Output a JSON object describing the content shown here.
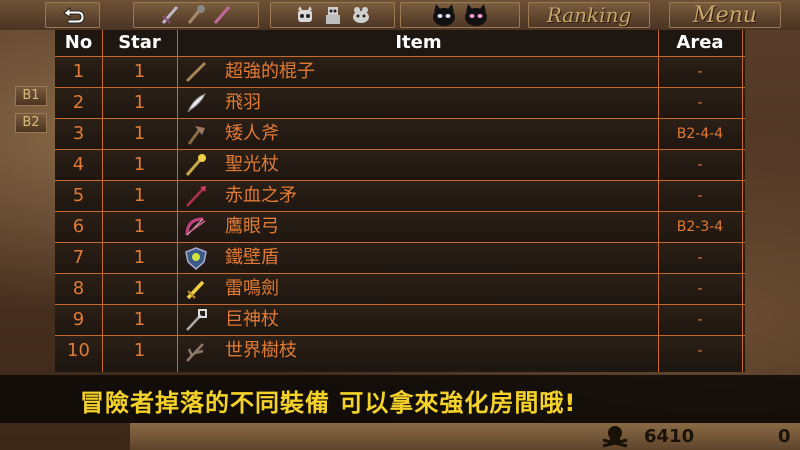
{
  "toolbar": {
    "ranking_label": "Ranking",
    "menu_label": "Menu"
  },
  "side_tags": [
    "B1",
    "B2"
  ],
  "table": {
    "headers": {
      "no": "No",
      "star": "Star",
      "item": "Item",
      "area": "Area"
    },
    "rows": [
      {
        "no": "1",
        "star": "1",
        "item": "超強的棍子",
        "area": "-",
        "icon": "stick-icon"
      },
      {
        "no": "2",
        "star": "1",
        "item": "飛羽",
        "area": "-",
        "icon": "feather-icon"
      },
      {
        "no": "3",
        "star": "1",
        "item": "矮人斧",
        "area": "B2-4-4",
        "icon": "axe-icon"
      },
      {
        "no": "4",
        "star": "1",
        "item": "聖光杖",
        "area": "-",
        "icon": "holy-staff-icon"
      },
      {
        "no": "5",
        "star": "1",
        "item": "赤血之矛",
        "area": "-",
        "icon": "spear-icon"
      },
      {
        "no": "6",
        "star": "1",
        "item": "鷹眼弓",
        "area": "B2-3-4",
        "icon": "bow-icon"
      },
      {
        "no": "7",
        "star": "1",
        "item": "鐵壁盾",
        "area": "-",
        "icon": "shield-icon"
      },
      {
        "no": "8",
        "star": "1",
        "item": "雷鳴劍",
        "area": "-",
        "icon": "sword-icon"
      },
      {
        "no": "9",
        "star": "1",
        "item": "巨神杖",
        "area": "-",
        "icon": "giant-staff-icon"
      },
      {
        "no": "10",
        "star": "1",
        "item": "世界樹枝",
        "area": "-",
        "icon": "branch-icon"
      }
    ]
  },
  "caption": "冒險者掉落的不同裝備  可以拿來強化房間哦!",
  "bottom": {
    "score": "6410",
    "count": "0"
  }
}
